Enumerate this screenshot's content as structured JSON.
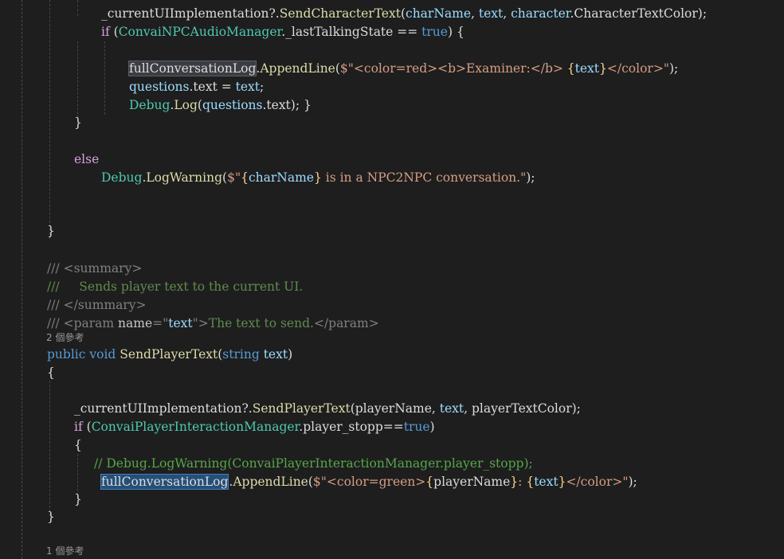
{
  "editor": {
    "background": "#1e1e1e",
    "lines": [
      [
        {
          "t": "_currentUIImplementation?.",
          "c": "plain"
        },
        {
          "t": "SendCharacterText",
          "c": "method"
        },
        {
          "t": "(",
          "c": "plain"
        },
        {
          "t": "charName",
          "c": "param"
        },
        {
          "t": ", ",
          "c": "plain"
        },
        {
          "t": "text",
          "c": "param"
        },
        {
          "t": ", ",
          "c": "plain"
        },
        {
          "t": "character",
          "c": "param"
        },
        {
          "t": ".CharacterTextColor);",
          "c": "plain"
        }
      ],
      [
        {
          "t": "if",
          "c": "kw2"
        },
        {
          "t": " (",
          "c": "plain"
        },
        {
          "t": "ConvaiNPCAudioManager",
          "c": "type"
        },
        {
          "t": "._lastTalkingState == ",
          "c": "plain"
        },
        {
          "t": "true",
          "c": "kw"
        },
        {
          "t": ") {",
          "c": "plain"
        }
      ],
      [
        {
          "t": "fullConversationLog",
          "c": "plain",
          "hl": "ref"
        },
        {
          "t": ".",
          "c": "plain"
        },
        {
          "t": "AppendLine",
          "c": "method"
        },
        {
          "t": "(",
          "c": "plain"
        },
        {
          "t": "$\"",
          "c": "str"
        },
        {
          "t": "<color=red><b>Examiner:</b> ",
          "c": "str"
        },
        {
          "t": "{",
          "c": "esc"
        },
        {
          "t": "text",
          "c": "param"
        },
        {
          "t": "}",
          "c": "esc"
        },
        {
          "t": "</color>\"",
          "c": "str"
        },
        {
          "t": ");",
          "c": "plain"
        }
      ],
      [
        {
          "t": "questions",
          "c": "param"
        },
        {
          "t": ".text = ",
          "c": "plain"
        },
        {
          "t": "text",
          "c": "param"
        },
        {
          "t": ";",
          "c": "plain"
        }
      ],
      [
        {
          "t": "Debug",
          "c": "type"
        },
        {
          "t": ".",
          "c": "plain"
        },
        {
          "t": "Log",
          "c": "method"
        },
        {
          "t": "(",
          "c": "plain"
        },
        {
          "t": "questions",
          "c": "param"
        },
        {
          "t": ".text); }",
          "c": "plain"
        }
      ],
      [
        {
          "t": "}",
          "c": "plain"
        }
      ],
      [
        {
          "t": "else",
          "c": "kw2"
        }
      ],
      [
        {
          "t": "Debug",
          "c": "type"
        },
        {
          "t": ".",
          "c": "plain"
        },
        {
          "t": "LogWarning",
          "c": "method"
        },
        {
          "t": "(",
          "c": "plain"
        },
        {
          "t": "$\"",
          "c": "str"
        },
        {
          "t": "{",
          "c": "esc"
        },
        {
          "t": "charName",
          "c": "param"
        },
        {
          "t": "}",
          "c": "esc"
        },
        {
          "t": " is in a NPC2NPC conversation.\"",
          "c": "str"
        },
        {
          "t": ");",
          "c": "plain"
        }
      ],
      [
        {
          "t": "}",
          "c": "plain"
        }
      ],
      [
        {
          "t": "/// ",
          "c": "xmltag"
        },
        {
          "t": "<summary>",
          "c": "xmltag"
        }
      ],
      [
        {
          "t": "///     Sends player text to the current UI.",
          "c": "xmldoc",
          "pre": "///",
          "prec": "xmltag"
        }
      ],
      [
        {
          "t": "/// ",
          "c": "xmltag"
        },
        {
          "t": "</summary>",
          "c": "xmltag"
        }
      ],
      [
        {
          "t": "/// ",
          "c": "xmltag"
        },
        {
          "t": "<param ",
          "c": "xmltag"
        },
        {
          "t": "name",
          "c": "xmlattr"
        },
        {
          "t": "=\"",
          "c": "xmltag"
        },
        {
          "t": "text",
          "c": "param"
        },
        {
          "t": "\">",
          "c": "xmltag"
        },
        {
          "t": "The text to send.",
          "c": "xmldoc"
        },
        {
          "t": "</param>",
          "c": "xmltag"
        }
      ],
      [
        {
          "t": "public",
          "c": "kw"
        },
        {
          "t": " ",
          "c": "plain"
        },
        {
          "t": "void",
          "c": "kw"
        },
        {
          "t": " ",
          "c": "plain"
        },
        {
          "t": "SendPlayerText",
          "c": "method"
        },
        {
          "t": "(",
          "c": "plain"
        },
        {
          "t": "string",
          "c": "kw"
        },
        {
          "t": " ",
          "c": "plain"
        },
        {
          "t": "text",
          "c": "param"
        },
        {
          "t": ")",
          "c": "plain"
        }
      ],
      [
        {
          "t": "{",
          "c": "plain"
        }
      ],
      [
        {
          "t": "_currentUIImplementation?.",
          "c": "plain"
        },
        {
          "t": "SendPlayerText",
          "c": "method"
        },
        {
          "t": "(playerName, ",
          "c": "plain"
        },
        {
          "t": "text",
          "c": "param"
        },
        {
          "t": ", playerTextColor);",
          "c": "plain"
        }
      ],
      [
        {
          "t": "if",
          "c": "kw2"
        },
        {
          "t": " (",
          "c": "plain"
        },
        {
          "t": "ConvaiPlayerInteractionManager",
          "c": "type"
        },
        {
          "t": ".player_stopp==",
          "c": "plain"
        },
        {
          "t": "true",
          "c": "kw"
        },
        {
          "t": ")",
          "c": "plain"
        }
      ],
      [
        {
          "t": "{",
          "c": "plain"
        }
      ],
      [
        {
          "t": "// Debug.LogWarning(ConvaiPlayerInteractionManager.player_stopp);",
          "c": "cmt"
        }
      ],
      [
        {
          "t": "fullConversationLog",
          "c": "plain",
          "hl": "sel"
        },
        {
          "t": ".",
          "c": "plain",
          "caret": true
        },
        {
          "t": "AppendLine",
          "c": "method"
        },
        {
          "t": "(",
          "c": "plain"
        },
        {
          "t": "$\"",
          "c": "str"
        },
        {
          "t": "<color=green>",
          "c": "str"
        },
        {
          "t": "{",
          "c": "esc"
        },
        {
          "t": "playerName",
          "c": "plain"
        },
        {
          "t": "}",
          "c": "esc"
        },
        {
          "t": ": ",
          "c": "str"
        },
        {
          "t": "{",
          "c": "esc"
        },
        {
          "t": "text",
          "c": "param"
        },
        {
          "t": "}",
          "c": "esc"
        },
        {
          "t": "</color>\"",
          "c": "str"
        },
        {
          "t": ");",
          "c": "plain"
        }
      ],
      [
        {
          "t": "}",
          "c": "plain"
        }
      ],
      [
        {
          "t": "}",
          "c": "plain"
        }
      ]
    ],
    "codelens": [
      "2 個參考",
      "1 個參考"
    ]
  }
}
